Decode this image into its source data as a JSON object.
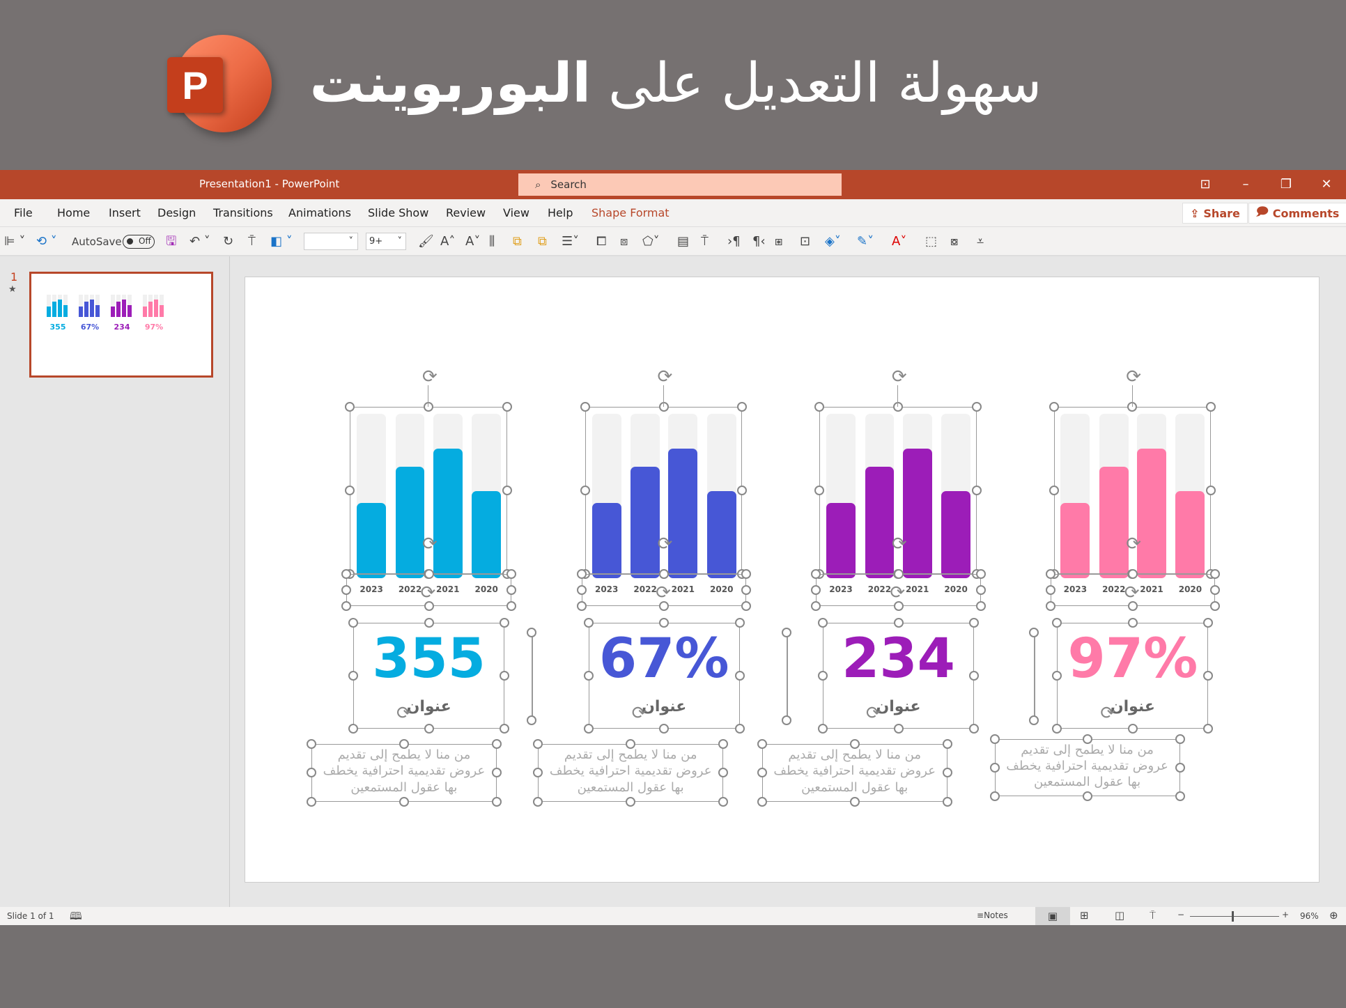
{
  "banner": {
    "headline_regular": "سهولة التعديل على",
    "headline_bold": "البوربوينت",
    "logo_letter": "P"
  },
  "titlebar": {
    "title": "Presentation1  -  PowerPoint",
    "search_placeholder": "Search",
    "buttons": [
      "⊡",
      "–",
      "❐",
      "✕"
    ],
    "color": "#b7472a"
  },
  "menu": {
    "tabs": [
      "File",
      "Home",
      "Insert",
      "Design",
      "Transitions",
      "Animations",
      "Slide Show",
      "Review",
      "View",
      "Help",
      "Shape Format"
    ],
    "active": "Shape Format",
    "share": "Share",
    "comments": "Comments"
  },
  "toolbar": {
    "autosave_label": "AutoSave",
    "autosave_state": "Off",
    "font_name": "",
    "font_size": "9+"
  },
  "thumbnail": {
    "slide_number": "1",
    "star": "★"
  },
  "statusbar": {
    "slide_info": "Slide 1 of 1",
    "notes": "Notes",
    "zoom": "96%"
  },
  "cards": [
    {
      "value": "355",
      "title": "عنوان",
      "color": "#05ace0"
    },
    {
      "value": "67%",
      "title": "عنوان",
      "color": "#4757d6"
    },
    {
      "value": "234",
      "title": "عنوان",
      "color": "#9c1db8"
    },
    {
      "value": "97%",
      "title": "عنوان",
      "color": "#ff7aa8"
    }
  ],
  "description_lines": [
    "من منا لا يطمح إلى تقديم",
    "عروض تقديمية احترافية يخطف",
    "بها عقول المستمعين"
  ],
  "chart_data": {
    "type": "bar",
    "categories": [
      "2023",
      "2022",
      "2021",
      "2020"
    ],
    "values": [
      46,
      68,
      79,
      53
    ],
    "ylim": [
      0,
      100
    ],
    "grid": false,
    "note_track": "bars shown as fill of light-gray track"
  }
}
